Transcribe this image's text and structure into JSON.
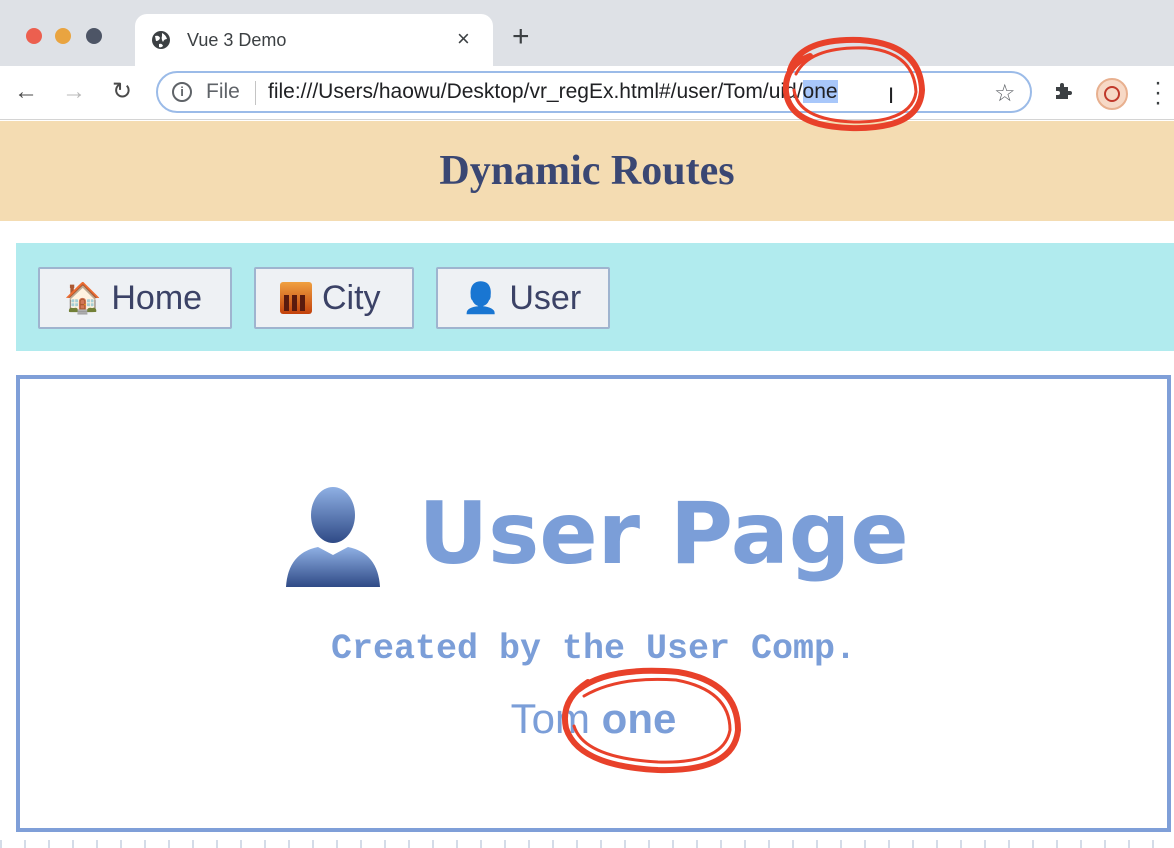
{
  "browser": {
    "tab_title": "Vue 3 Demo",
    "tab_close": "×",
    "new_tab": "+",
    "scheme_label": "File",
    "url_base": "file:///Users/haowu/Desktop/vr_regEx.html#/user/Tom/uid/",
    "url_selected": "one",
    "icons": {
      "back": "back-arrow-icon",
      "forward": "forward-arrow-icon",
      "reload": "reload-icon",
      "info": "info-icon",
      "bookmark": "star-icon",
      "extensions": "puzzle-icon",
      "profile": "avatar-icon",
      "menu": "kebab-menu-icon"
    }
  },
  "page": {
    "title": "Dynamic Routes",
    "nav": [
      {
        "icon": "🏠",
        "label": "Home"
      },
      {
        "icon": "city-icon",
        "label": "City"
      },
      {
        "icon": "👤",
        "label": "User"
      }
    ],
    "user_view": {
      "heading": "User Page",
      "subtitle": "Created by the User Comp.",
      "name": "Tom",
      "uid": "one"
    }
  },
  "colors": {
    "header_bg": "#f4dcb2",
    "nav_bg": "#b1ebee",
    "accent_blue": "#7b9ed8",
    "annotation_red": "#e8412a"
  }
}
